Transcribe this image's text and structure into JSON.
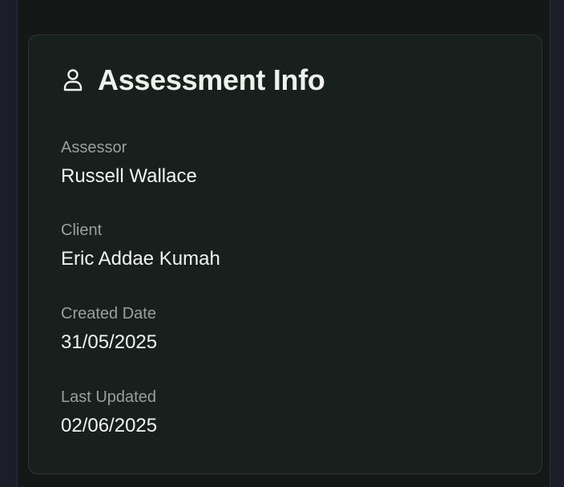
{
  "card": {
    "icon": "user-icon",
    "title": "Assessment Info",
    "fields": [
      {
        "label": "Assessor",
        "value": "Russell Wallace"
      },
      {
        "label": "Client",
        "value": "Eric Addae Kumah"
      },
      {
        "label": "Created Date",
        "value": "31/05/2025"
      },
      {
        "label": "Last Updated",
        "value": "02/06/2025"
      }
    ]
  },
  "colors": {
    "background": "#141817",
    "card_background": "#18201d",
    "card_border": "#2d3632",
    "title": "#eef2ef",
    "label": "#97a19c",
    "value": "#f1f4f2"
  }
}
